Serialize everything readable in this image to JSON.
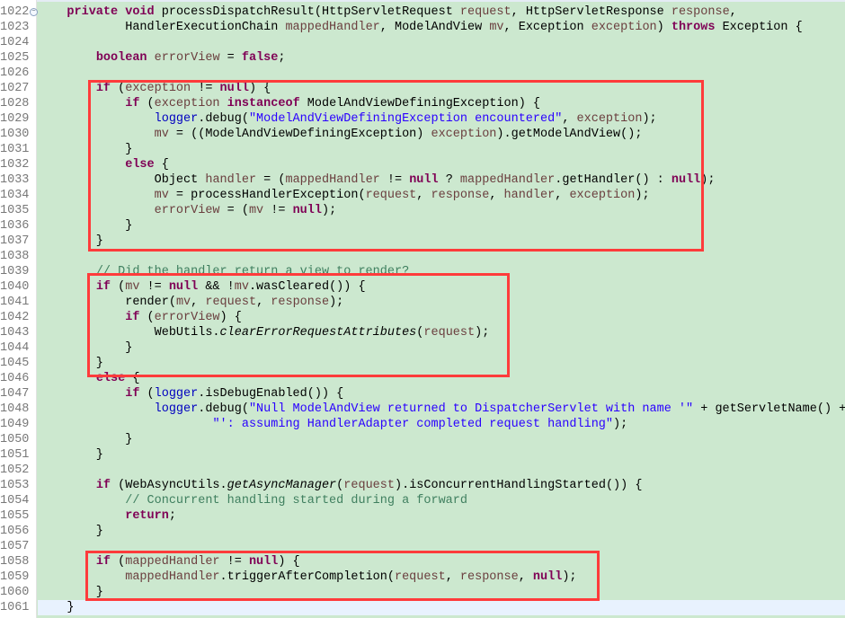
{
  "editor": {
    "colors": {
      "background": "#cce8cf",
      "keyword": "#7f0055",
      "variable": "#6a3e3e",
      "string": "#2a00ff",
      "comment": "#3f7f5f",
      "field": "#0000c0",
      "highlight_box": "#ff3b3b",
      "current_line": "#e8f2fe"
    },
    "fold_icon": "collapse-minus-icon",
    "current_line": "1061",
    "lines": [
      {
        "n": "1022",
        "fold": true,
        "t": [
          [
            "p",
            "    "
          ],
          [
            "k",
            "private"
          ],
          [
            "p",
            " "
          ],
          [
            "k",
            "void"
          ],
          [
            "p",
            " processDispatchResult(HttpServletRequest "
          ],
          [
            "v",
            "request"
          ],
          [
            "p",
            ", HttpServletResponse "
          ],
          [
            "v",
            "response"
          ],
          [
            "p",
            ","
          ]
        ]
      },
      {
        "n": "1023",
        "t": [
          [
            "p",
            "            HandlerExecutionChain "
          ],
          [
            "v",
            "mappedHandler"
          ],
          [
            "p",
            ", ModelAndView "
          ],
          [
            "v",
            "mv"
          ],
          [
            "p",
            ", Exception "
          ],
          [
            "v",
            "exception"
          ],
          [
            "p",
            ") "
          ],
          [
            "k",
            "throws"
          ],
          [
            "p",
            " Exception {"
          ]
        ]
      },
      {
        "n": "1024",
        "t": []
      },
      {
        "n": "1025",
        "t": [
          [
            "p",
            "        "
          ],
          [
            "k",
            "boolean"
          ],
          [
            "p",
            " "
          ],
          [
            "v",
            "errorView"
          ],
          [
            "p",
            " = "
          ],
          [
            "k",
            "false"
          ],
          [
            "p",
            ";"
          ]
        ]
      },
      {
        "n": "1026",
        "t": []
      },
      {
        "n": "1027",
        "t": [
          [
            "p",
            "        "
          ],
          [
            "k",
            "if"
          ],
          [
            "p",
            " ("
          ],
          [
            "v",
            "exception"
          ],
          [
            "p",
            " != "
          ],
          [
            "k",
            "null"
          ],
          [
            "p",
            ") {"
          ]
        ]
      },
      {
        "n": "1028",
        "t": [
          [
            "p",
            "            "
          ],
          [
            "k",
            "if"
          ],
          [
            "p",
            " ("
          ],
          [
            "v",
            "exception"
          ],
          [
            "p",
            " "
          ],
          [
            "k",
            "instanceof"
          ],
          [
            "p",
            " ModelAndViewDefiningException) {"
          ]
        ]
      },
      {
        "n": "1029",
        "t": [
          [
            "p",
            "                "
          ],
          [
            "f",
            "logger"
          ],
          [
            "p",
            ".debug("
          ],
          [
            "s",
            "\"ModelAndViewDefiningException encountered\""
          ],
          [
            "p",
            ", "
          ],
          [
            "v",
            "exception"
          ],
          [
            "p",
            ");"
          ]
        ]
      },
      {
        "n": "1030",
        "t": [
          [
            "p",
            "                "
          ],
          [
            "v",
            "mv"
          ],
          [
            "p",
            " = ((ModelAndViewDefiningException) "
          ],
          [
            "v",
            "exception"
          ],
          [
            "p",
            ").getModelAndView();"
          ]
        ]
      },
      {
        "n": "1031",
        "t": [
          [
            "p",
            "            }"
          ]
        ]
      },
      {
        "n": "1032",
        "t": [
          [
            "p",
            "            "
          ],
          [
            "k",
            "else"
          ],
          [
            "p",
            " {"
          ]
        ]
      },
      {
        "n": "1033",
        "t": [
          [
            "p",
            "                Object "
          ],
          [
            "v",
            "handler"
          ],
          [
            "p",
            " = ("
          ],
          [
            "v",
            "mappedHandler"
          ],
          [
            "p",
            " != "
          ],
          [
            "k",
            "null"
          ],
          [
            "p",
            " ? "
          ],
          [
            "v",
            "mappedHandler"
          ],
          [
            "p",
            ".getHandler() : "
          ],
          [
            "k",
            "null"
          ],
          [
            "p",
            ");"
          ]
        ]
      },
      {
        "n": "1034",
        "t": [
          [
            "p",
            "                "
          ],
          [
            "v",
            "mv"
          ],
          [
            "p",
            " = processHandlerException("
          ],
          [
            "v",
            "request"
          ],
          [
            "p",
            ", "
          ],
          [
            "v",
            "response"
          ],
          [
            "p",
            ", "
          ],
          [
            "v",
            "handler"
          ],
          [
            "p",
            ", "
          ],
          [
            "v",
            "exception"
          ],
          [
            "p",
            ");"
          ]
        ]
      },
      {
        "n": "1035",
        "t": [
          [
            "p",
            "                "
          ],
          [
            "v",
            "errorView"
          ],
          [
            "p",
            " = ("
          ],
          [
            "v",
            "mv"
          ],
          [
            "p",
            " != "
          ],
          [
            "k",
            "null"
          ],
          [
            "p",
            ");"
          ]
        ]
      },
      {
        "n": "1036",
        "t": [
          [
            "p",
            "            }"
          ]
        ]
      },
      {
        "n": "1037",
        "t": [
          [
            "p",
            "        }"
          ]
        ]
      },
      {
        "n": "1038",
        "t": []
      },
      {
        "n": "1039",
        "t": [
          [
            "p",
            "        "
          ],
          [
            "c",
            "// Did the handler return a view to render?"
          ]
        ]
      },
      {
        "n": "1040",
        "t": [
          [
            "p",
            "        "
          ],
          [
            "k",
            "if"
          ],
          [
            "p",
            " ("
          ],
          [
            "v",
            "mv"
          ],
          [
            "p",
            " != "
          ],
          [
            "k",
            "null"
          ],
          [
            "p",
            " && !"
          ],
          [
            "v",
            "mv"
          ],
          [
            "p",
            ".wasCleared()) {"
          ]
        ]
      },
      {
        "n": "1041",
        "t": [
          [
            "p",
            "            render("
          ],
          [
            "v",
            "mv"
          ],
          [
            "p",
            ", "
          ],
          [
            "v",
            "request"
          ],
          [
            "p",
            ", "
          ],
          [
            "v",
            "response"
          ],
          [
            "p",
            ");"
          ]
        ]
      },
      {
        "n": "1042",
        "t": [
          [
            "p",
            "            "
          ],
          [
            "k",
            "if"
          ],
          [
            "p",
            " ("
          ],
          [
            "v",
            "errorView"
          ],
          [
            "p",
            ") {"
          ]
        ]
      },
      {
        "n": "1043",
        "t": [
          [
            "p",
            "                WebUtils."
          ],
          [
            "i",
            "clearErrorRequestAttributes"
          ],
          [
            "p",
            "("
          ],
          [
            "v",
            "request"
          ],
          [
            "p",
            ");"
          ]
        ]
      },
      {
        "n": "1044",
        "t": [
          [
            "p",
            "            }"
          ]
        ]
      },
      {
        "n": "1045",
        "t": [
          [
            "p",
            "        }"
          ]
        ]
      },
      {
        "n": "1046",
        "t": [
          [
            "p",
            "        "
          ],
          [
            "k",
            "else"
          ],
          [
            "p",
            " {"
          ]
        ]
      },
      {
        "n": "1047",
        "t": [
          [
            "p",
            "            "
          ],
          [
            "k",
            "if"
          ],
          [
            "p",
            " ("
          ],
          [
            "f",
            "logger"
          ],
          [
            "p",
            ".isDebugEnabled()) {"
          ]
        ]
      },
      {
        "n": "1048",
        "t": [
          [
            "p",
            "                "
          ],
          [
            "f",
            "logger"
          ],
          [
            "p",
            ".debug("
          ],
          [
            "s",
            "\"Null ModelAndView returned to DispatcherServlet with name '\""
          ],
          [
            "p",
            " + getServletName() +"
          ]
        ]
      },
      {
        "n": "1049",
        "t": [
          [
            "p",
            "                        "
          ],
          [
            "s",
            "\"': assuming HandlerAdapter completed request handling\""
          ],
          [
            "p",
            ");"
          ]
        ]
      },
      {
        "n": "1050",
        "t": [
          [
            "p",
            "            }"
          ]
        ]
      },
      {
        "n": "1051",
        "t": [
          [
            "p",
            "        }"
          ]
        ]
      },
      {
        "n": "1052",
        "t": []
      },
      {
        "n": "1053",
        "t": [
          [
            "p",
            "        "
          ],
          [
            "k",
            "if"
          ],
          [
            "p",
            " (WebAsyncUtils."
          ],
          [
            "i",
            "getAsyncManager"
          ],
          [
            "p",
            "("
          ],
          [
            "v",
            "request"
          ],
          [
            "p",
            ").isConcurrentHandlingStarted()) {"
          ]
        ]
      },
      {
        "n": "1054",
        "t": [
          [
            "p",
            "            "
          ],
          [
            "c",
            "// Concurrent handling started during a forward"
          ]
        ]
      },
      {
        "n": "1055",
        "t": [
          [
            "p",
            "            "
          ],
          [
            "k",
            "return"
          ],
          [
            "p",
            ";"
          ]
        ]
      },
      {
        "n": "1056",
        "t": [
          [
            "p",
            "        }"
          ]
        ]
      },
      {
        "n": "1057",
        "t": []
      },
      {
        "n": "1058",
        "t": [
          [
            "p",
            "        "
          ],
          [
            "k",
            "if"
          ],
          [
            "p",
            " ("
          ],
          [
            "v",
            "mappedHandler"
          ],
          [
            "p",
            " != "
          ],
          [
            "k",
            "null"
          ],
          [
            "p",
            ") {"
          ]
        ]
      },
      {
        "n": "1059",
        "t": [
          [
            "p",
            "            "
          ],
          [
            "v",
            "mappedHandler"
          ],
          [
            "p",
            ".triggerAfterCompletion("
          ],
          [
            "v",
            "request"
          ],
          [
            "p",
            ", "
          ],
          [
            "v",
            "response"
          ],
          [
            "p",
            ", "
          ],
          [
            "k",
            "null"
          ],
          [
            "p",
            ");"
          ]
        ]
      },
      {
        "n": "1060",
        "t": [
          [
            "p",
            "        }"
          ]
        ]
      },
      {
        "n": "1061",
        "t": [
          [
            "p",
            "    }"
          ]
        ]
      }
    ]
  }
}
